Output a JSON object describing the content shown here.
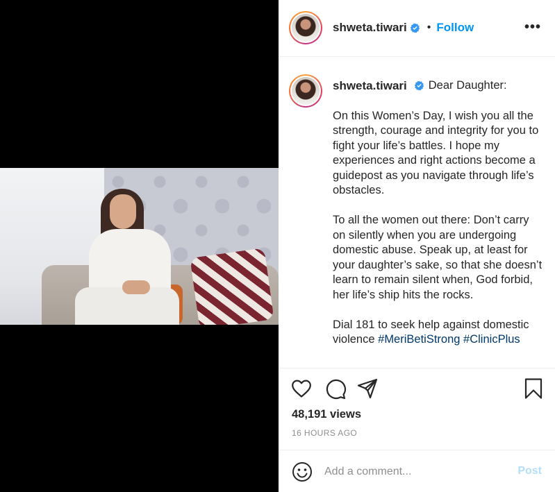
{
  "user": {
    "username": "shweta.tiwari",
    "follow_label": "Follow",
    "separator": "•",
    "more_label": "•••"
  },
  "caption": {
    "username": "shweta.tiwari",
    "greeting": "Dear Daughter:",
    "paragraphs": [
      "On this Women’s Day, I wish you all the strength, courage and integrity for you to fight your life’s battles. I hope my experiences and right actions become a guidepost as you navigate through life’s obstacles.",
      "To all the women out there: Don’t carry on silently when you are undergoing domestic abuse. Speak up, at least for your daughter’s sake, so that she doesn’t learn to remain silent when, God forbid, her life’s ship hits the rocks."
    ],
    "last_text": "Dial 181 to seek help against domestic violence",
    "hashtags": [
      "#MeriBetiStrong",
      "#ClinicPlus"
    ]
  },
  "actions": {
    "icons": [
      "heart-icon",
      "comment-icon",
      "share-icon",
      "bookmark-icon"
    ]
  },
  "stats": {
    "views": "48,191 views",
    "timestamp": "16 HOURS AGO"
  },
  "comment_box": {
    "placeholder": "Add a comment...",
    "post_label": "Post",
    "emoji_icon": "smiley-icon"
  },
  "colors": {
    "link_blue": "#0095f6",
    "hashtag": "#00376b",
    "post_disabled": "#b2dffc",
    "muted": "#8e8e8e"
  }
}
